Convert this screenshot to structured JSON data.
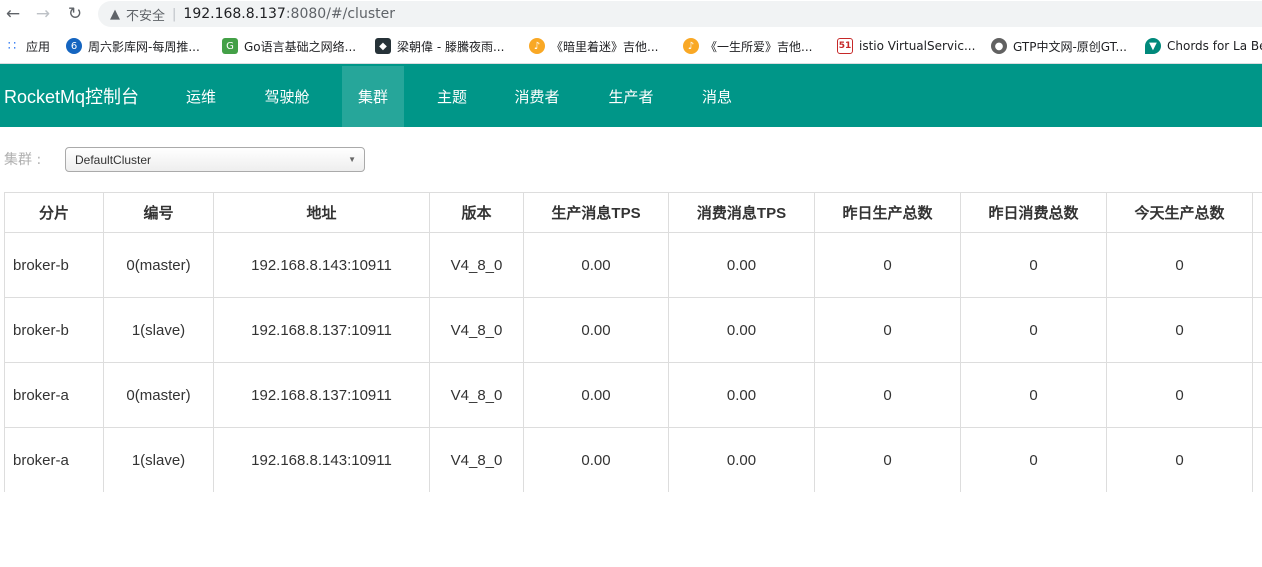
{
  "browser": {
    "back_icon": "back-arrow-icon",
    "forward_icon": "forward-arrow-icon",
    "reload_icon": "reload-icon",
    "security_label": "不安全",
    "url_host": "192.168.8.137",
    "url_rest": ":8080/#/cluster",
    "bookmarks": [
      {
        "label": "应用",
        "icon": "apps-grid-icon",
        "color": "#4285f4"
      },
      {
        "label": "周六影库网-每周推...",
        "icon": "site-icon",
        "color": "#1565c0"
      },
      {
        "label": "Go语言基础之网络...",
        "icon": "gopher-icon",
        "color": "#43a047"
      },
      {
        "label": "梁朝偉 - 滕騰夜雨...",
        "icon": "shield-icon",
        "color": "#263238"
      },
      {
        "label": "《暗里着迷》吉他...",
        "icon": "guitar-site-icon",
        "color": "#f9a825"
      },
      {
        "label": "《一生所爱》吉他...",
        "icon": "guitar-site-icon",
        "color": "#f9a825"
      },
      {
        "label": "istio VirtualServic...",
        "icon": "51cto-icon",
        "color": "#c62828"
      },
      {
        "label": "GTP中文网-原创GT...",
        "icon": "globe-icon",
        "color": "#616161"
      },
      {
        "label": "Chords for La Be",
        "icon": "pick-icon",
        "color": "#00897b"
      }
    ]
  },
  "app": {
    "brand": "RocketMq控制台",
    "nav_color": "#009688",
    "nav": [
      {
        "label": "运维",
        "active": false
      },
      {
        "label": "驾驶舱",
        "active": false
      },
      {
        "label": "集群",
        "active": true
      },
      {
        "label": "主题",
        "active": false
      },
      {
        "label": "消费者",
        "active": false
      },
      {
        "label": "生产者",
        "active": false
      },
      {
        "label": "消息",
        "active": false
      }
    ]
  },
  "cluster": {
    "label": "集群 :",
    "selected": "DefaultCluster"
  },
  "table": {
    "headers": [
      "分片",
      "编号",
      "地址",
      "版本",
      "生产消息TPS",
      "消费消息TPS",
      "昨日生产总数",
      "昨日消费总数",
      "今天生产总数"
    ],
    "rows": [
      [
        "broker-b",
        "0(master)",
        "192.168.8.143:10911",
        "V4_8_0",
        "0.00",
        "0.00",
        "0",
        "0",
        "0"
      ],
      [
        "broker-b",
        "1(slave)",
        "192.168.8.137:10911",
        "V4_8_0",
        "0.00",
        "0.00",
        "0",
        "0",
        "0"
      ],
      [
        "broker-a",
        "0(master)",
        "192.168.8.137:10911",
        "V4_8_0",
        "0.00",
        "0.00",
        "0",
        "0",
        "0"
      ],
      [
        "broker-a",
        "1(slave)",
        "192.168.8.143:10911",
        "V4_8_0",
        "0.00",
        "0.00",
        "0",
        "0",
        "0"
      ]
    ]
  }
}
